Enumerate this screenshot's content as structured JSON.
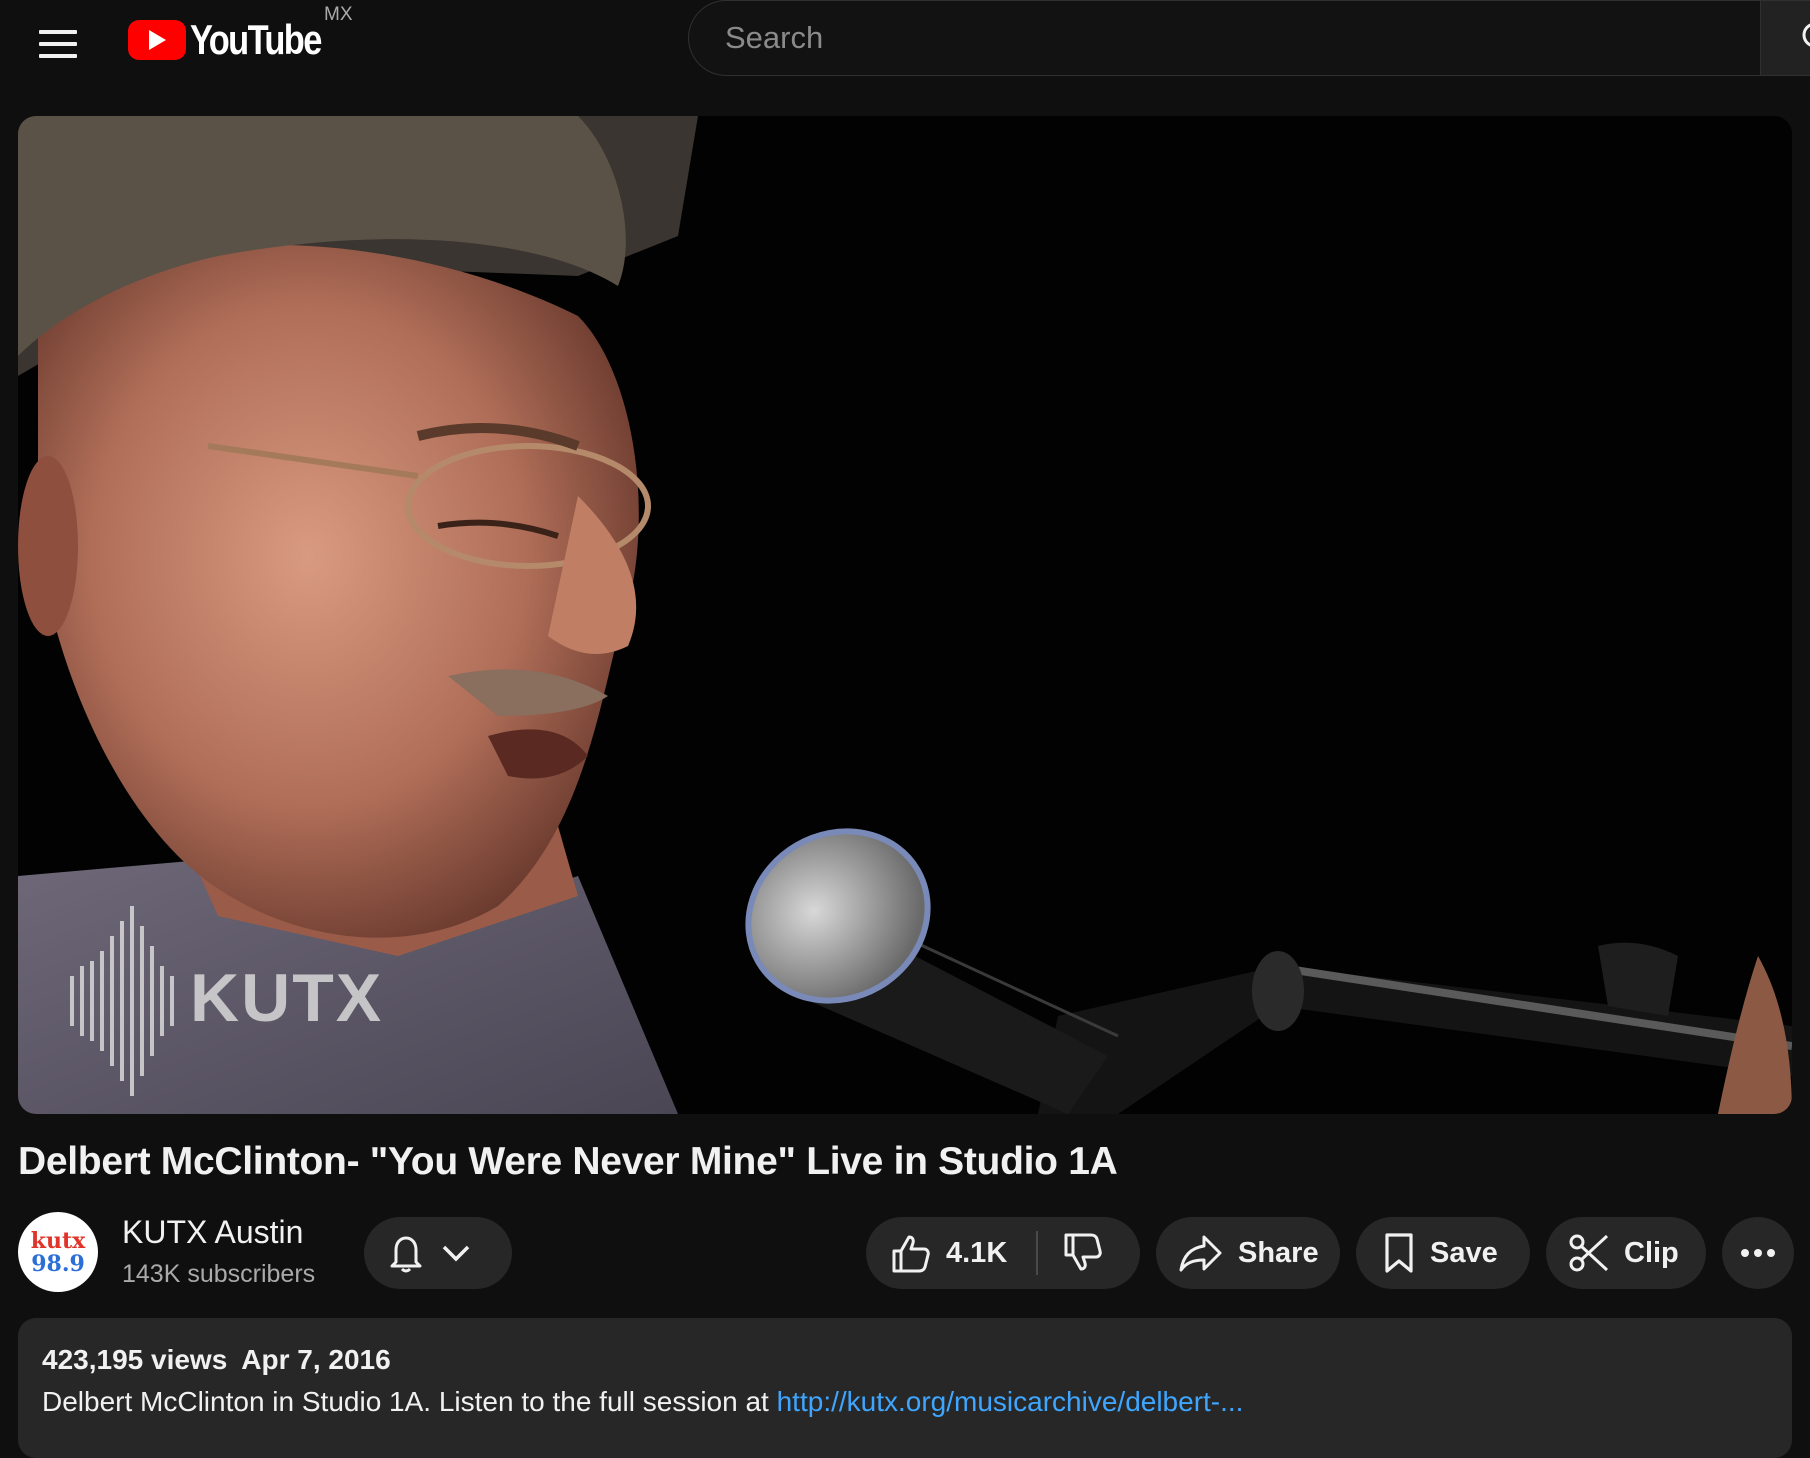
{
  "header": {
    "logo_text": "YouTube",
    "country_code": "MX",
    "search_placeholder": "Search"
  },
  "player": {
    "watermark": "KUTX"
  },
  "video": {
    "title": "Delbert McClinton- \"You Were Never Mine\" Live in Studio 1A"
  },
  "channel": {
    "avatar_line1": "kutx",
    "avatar_line2": "98.9",
    "name": "KUTX Austin",
    "subscribers": "143K subscribers"
  },
  "actions": {
    "like_count": "4.1K",
    "share_label": "Share",
    "save_label": "Save",
    "clip_label": "Clip"
  },
  "description": {
    "views": "423,195 views",
    "date": "Apr 7, 2016",
    "text": "Delbert McClinton in Studio 1A. Listen to the full session at ",
    "link": "http://kutx.org/musicarchive/delbert-..."
  },
  "colors": {
    "background": "#0f0f0f",
    "brand_red": "#ff0000",
    "pill_bg": "#272727",
    "link": "#3ea6ff"
  },
  "icons": [
    "menu-icon",
    "youtube-play-icon",
    "search-icon",
    "bell-icon",
    "chevron-down-icon",
    "thumbs-up-icon",
    "thumbs-down-icon",
    "share-icon",
    "bookmark-icon",
    "scissors-icon",
    "more-horizontal-icon"
  ]
}
